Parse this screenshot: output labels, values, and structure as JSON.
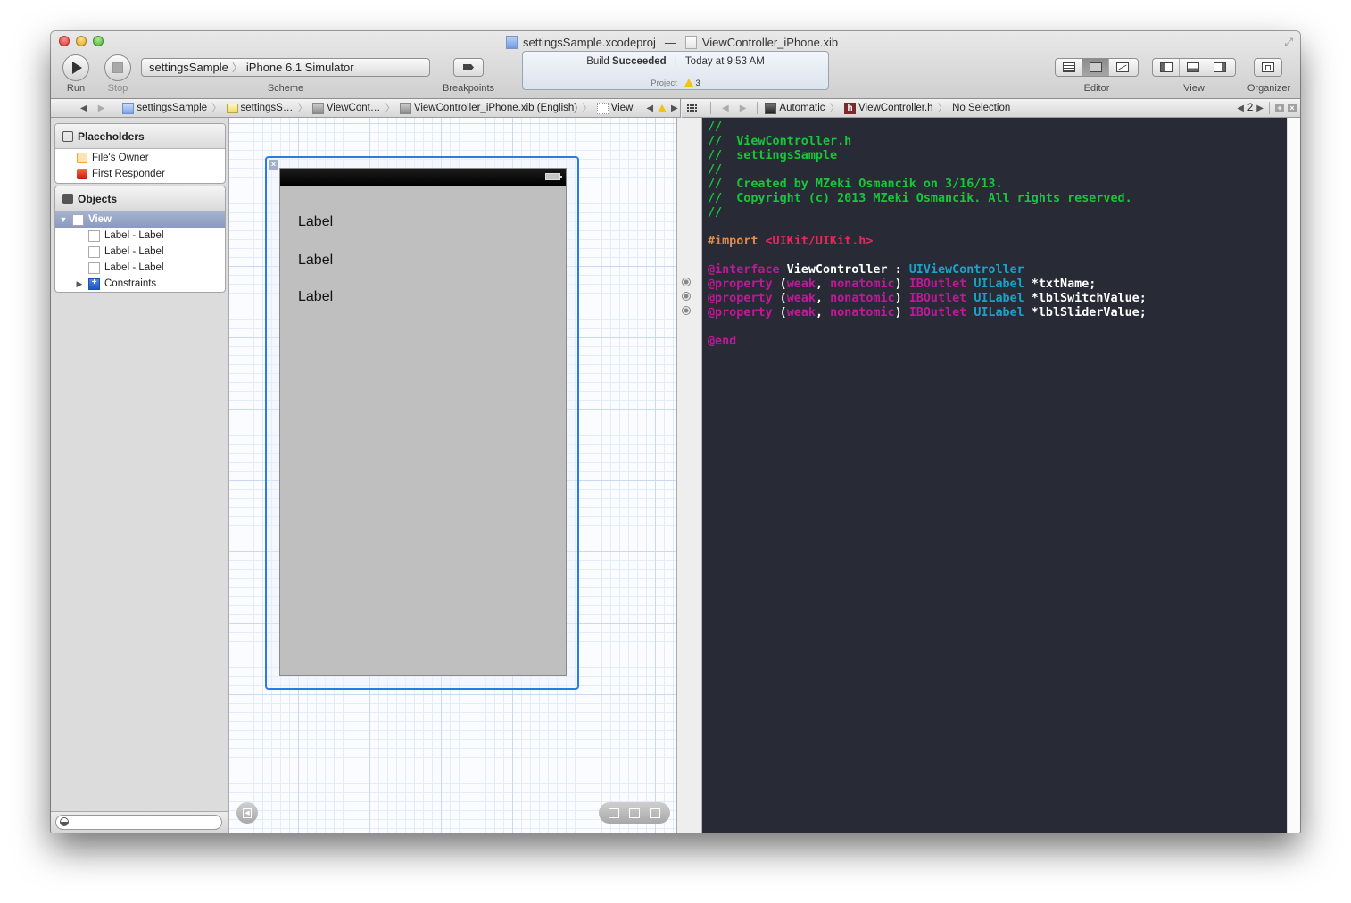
{
  "window": {
    "title_project": "settingsSample.xcodeproj",
    "title_separator": "—",
    "title_file": "ViewController_iPhone.xib"
  },
  "toolbar": {
    "run_label": "Run",
    "stop_label": "Stop",
    "scheme_target": "settingsSample",
    "scheme_destination": "iPhone 6.1 Simulator",
    "scheme_label": "Scheme",
    "breakpoints_label": "Breakpoints",
    "editor_label": "Editor",
    "view_label": "View",
    "organizer_label": "Organizer"
  },
  "activity": {
    "build_prefix": "Build",
    "build_status": "Succeeded",
    "time": "Today at 9:53 AM",
    "issues_label": "Project",
    "warning_count": "3"
  },
  "jumpbar_left": {
    "items": [
      "settingsSample",
      "settingsS…",
      "ViewCont…",
      "ViewController_iPhone.xib (English)",
      "View"
    ]
  },
  "jumpbar_right": {
    "items": [
      "Automatic",
      "ViewController.h",
      "No Selection"
    ],
    "counterpart_index": "2"
  },
  "outline": {
    "placeholders_header": "Placeholders",
    "placeholders": [
      "File's Owner",
      "First Responder"
    ],
    "objects_header": "Objects",
    "view_item": "View",
    "labels": [
      "Label - Label",
      "Label - Label",
      "Label - Label"
    ],
    "constraints_item": "Constraints",
    "filter_placeholder": ""
  },
  "canvas": {
    "labels": [
      "Label",
      "Label",
      "Label"
    ]
  },
  "editor": {
    "file_name": "ViewController.h",
    "lines": [
      [
        {
          "t": "//",
          "c": "c-com"
        }
      ],
      [
        {
          "t": "//  ViewController.h",
          "c": "c-com"
        }
      ],
      [
        {
          "t": "//  settingsSample",
          "c": "c-com"
        }
      ],
      [
        {
          "t": "//",
          "c": "c-com"
        }
      ],
      [
        {
          "t": "//  Created by MZeki Osmancik on 3/16/13.",
          "c": "c-com"
        }
      ],
      [
        {
          "t": "//  Copyright (c) 2013 MZeki Osmancik. All rights reserved.",
          "c": "c-com"
        }
      ],
      [
        {
          "t": "//",
          "c": "c-com"
        }
      ],
      [],
      [
        {
          "t": "#import ",
          "c": "c-pp"
        },
        {
          "t": "<UIKit/UIKit.h>",
          "c": "c-str"
        }
      ],
      [],
      [
        {
          "t": "@interface",
          "c": "c-kw"
        },
        {
          "t": " ViewController : ",
          "c": "c-plain"
        },
        {
          "t": "UIViewController",
          "c": "c-cls"
        }
      ],
      [
        {
          "t": "@property",
          "c": "c-kw"
        },
        {
          "t": " (",
          "c": "c-plain"
        },
        {
          "t": "weak",
          "c": "c-kw"
        },
        {
          "t": ", ",
          "c": "c-plain"
        },
        {
          "t": "nonatomic",
          "c": "c-kw"
        },
        {
          "t": ") ",
          "c": "c-plain"
        },
        {
          "t": "IBOutlet",
          "c": "c-kw"
        },
        {
          "t": " ",
          "c": "c-plain"
        },
        {
          "t": "UILabel",
          "c": "c-cls"
        },
        {
          "t": " *txtName;",
          "c": "c-plain"
        }
      ],
      [
        {
          "t": "@property",
          "c": "c-kw"
        },
        {
          "t": " (",
          "c": "c-plain"
        },
        {
          "t": "weak",
          "c": "c-kw"
        },
        {
          "t": ", ",
          "c": "c-plain"
        },
        {
          "t": "nonatomic",
          "c": "c-kw"
        },
        {
          "t": ") ",
          "c": "c-plain"
        },
        {
          "t": "IBOutlet",
          "c": "c-kw"
        },
        {
          "t": " ",
          "c": "c-plain"
        },
        {
          "t": "UILabel",
          "c": "c-cls"
        },
        {
          "t": " *lblSwitchValue;",
          "c": "c-plain"
        }
      ],
      [
        {
          "t": "@property",
          "c": "c-kw"
        },
        {
          "t": " (",
          "c": "c-plain"
        },
        {
          "t": "weak",
          "c": "c-kw"
        },
        {
          "t": ", ",
          "c": "c-plain"
        },
        {
          "t": "nonatomic",
          "c": "c-kw"
        },
        {
          "t": ") ",
          "c": "c-plain"
        },
        {
          "t": "IBOutlet",
          "c": "c-kw"
        },
        {
          "t": " ",
          "c": "c-plain"
        },
        {
          "t": "UILabel",
          "c": "c-cls"
        },
        {
          "t": " *lblSliderValue;",
          "c": "c-plain"
        }
      ],
      [],
      [
        {
          "t": "@end",
          "c": "c-kw"
        }
      ]
    ]
  },
  "colors": {
    "selection_blue": "#2b7be4",
    "editor_background": "#282b35",
    "comment": "#18c63b",
    "keyword": "#c0189a",
    "class": "#1aa3c9",
    "string": "#e8265c",
    "preprocessor": "#e28b4a"
  }
}
